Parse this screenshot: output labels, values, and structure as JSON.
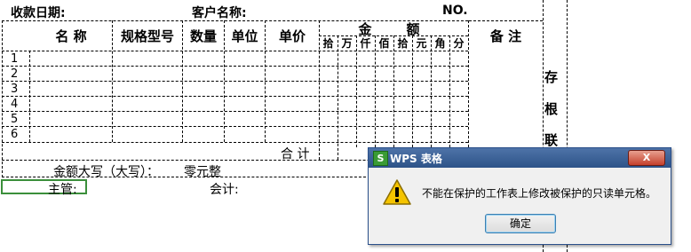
{
  "form": {
    "received_date_label": "收款日期:",
    "customer_label": "客户名称:",
    "no_label": "NO.",
    "columns": {
      "name": "名 称",
      "spec": "规格型号",
      "qty": "数量",
      "unit": "单位",
      "price": "单价",
      "amount": "金",
      "amount2": "额",
      "note": "备  注"
    },
    "digits": [
      "拾",
      "万",
      "仟",
      "佰",
      "拾",
      "元",
      "角",
      "分"
    ],
    "row_numbers": [
      "1",
      "2",
      "3",
      "4",
      "5",
      "6"
    ],
    "total_label": "合 计",
    "amount_words_label": "金额大写（大写）：",
    "amount_words_value": "零元整",
    "supervisor_label": "主管:",
    "accountant_label": "会计:",
    "side_labels": [
      "存",
      "根",
      "联"
    ]
  },
  "dialog": {
    "title": "WPS 表格",
    "logo_letter": "S",
    "message": "不能在保护的工作表上修改被保护的只读单元格。",
    "ok_label": "确定",
    "close_glyph": "X",
    "icon": "warning-icon",
    "colors": {
      "titlebar": "#2d5388",
      "close": "#c4402c",
      "warning": "#f5c400",
      "selection": "#3b8f3b"
    }
  }
}
